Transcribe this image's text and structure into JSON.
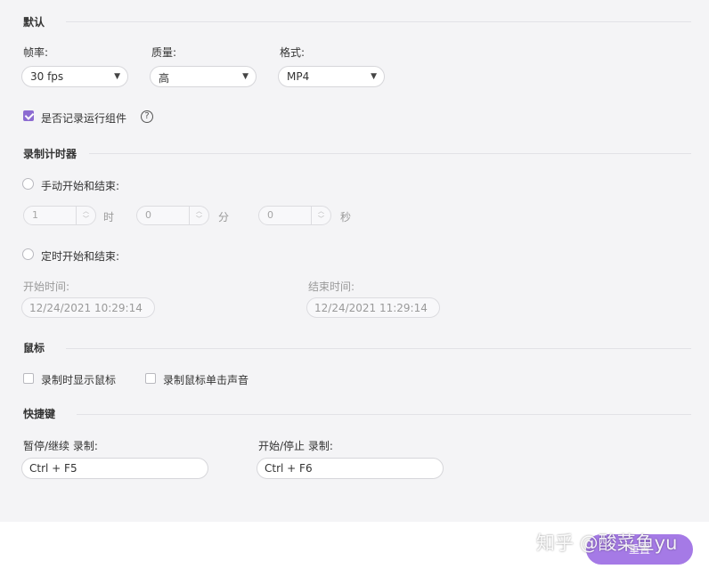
{
  "default_section": {
    "title": "默认",
    "fps": {
      "label": "帧率:",
      "value": "30 fps"
    },
    "quality": {
      "label": "质量:",
      "value": "高"
    },
    "format": {
      "label": "格式:",
      "value": "MP4"
    },
    "record_components": {
      "label": "是否记录运行组件",
      "checked": true
    },
    "help_symbol": "?"
  },
  "timer_section": {
    "title": "录制计时器",
    "manual": {
      "label": "手动开始和结束:",
      "hours": "1",
      "hours_unit": "时",
      "minutes": "0",
      "minutes_unit": "分",
      "seconds": "0",
      "seconds_unit": "秒"
    },
    "scheduled": {
      "label": "定时开始和结束:",
      "start_label": "开始时间:",
      "start_value": "12/24/2021 10:29:14",
      "end_label": "结束时间:",
      "end_value": "12/24/2021 11:29:14"
    }
  },
  "mouse_section": {
    "title": "鼠标",
    "show_cursor": {
      "label": "录制时显示鼠标",
      "checked": false
    },
    "click_sound": {
      "label": "录制鼠标单击声音",
      "checked": false
    }
  },
  "hotkey_section": {
    "title": "快捷键",
    "pause": {
      "label": "暂停/继续 录制:",
      "value": "Ctrl + F5"
    },
    "start_stop": {
      "label": "开始/停止 录制:",
      "value": "Ctrl + F6"
    }
  },
  "footer": {
    "reset_label": "重置",
    "watermark": "知乎 @酸菜鱼yu"
  },
  "icons": {
    "caret": "▼",
    "spin_up": "︿",
    "spin_down": "﹀"
  },
  "colors": {
    "accent": "#8c6bd1",
    "reset_button": "#a57ae6",
    "panel_bg": "#f4f4f6"
  }
}
